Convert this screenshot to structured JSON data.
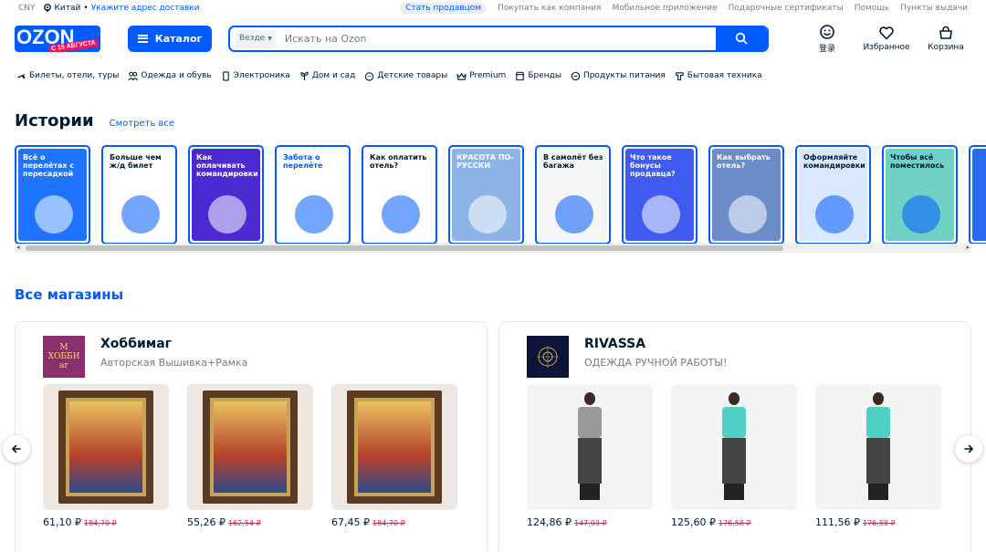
{
  "topbar": {
    "currency": "CNY",
    "location": "Китай",
    "delivery_link": "Укажите адрес доставки",
    "links": [
      "Стать продавцом",
      "Покупать как компания",
      "Мобильное приложение",
      "Подарочные сертификаты",
      "Помощь",
      "Пункты выдачи"
    ]
  },
  "header": {
    "logo_text": "OZON",
    "logo_promo": "С 15 АВГУСТА",
    "catalog_label": "Каталог",
    "search_scope": "Везде",
    "search_placeholder": "Искать на Ozon",
    "actions": [
      {
        "label": "登录",
        "icon": "smiley-icon"
      },
      {
        "label": "Избранное",
        "icon": "heart-icon"
      },
      {
        "label": "Корзина",
        "icon": "cart-icon"
      }
    ]
  },
  "categories": [
    {
      "label": "Билеты, отели, туры",
      "icon": "plane-icon"
    },
    {
      "label": "Одежда и обувь",
      "icon": "people-icon"
    },
    {
      "label": "Электроника",
      "icon": "phone-icon"
    },
    {
      "label": "Дом и сад",
      "icon": "plant-icon"
    },
    {
      "label": "Детские товары",
      "icon": "baby-icon"
    },
    {
      "label": "Premium",
      "icon": "crown-icon"
    },
    {
      "label": "Бренды",
      "icon": "store-icon"
    },
    {
      "label": "Продукты питания",
      "icon": "food-icon"
    },
    {
      "label": "Бытовая техника",
      "icon": "appliance-icon"
    }
  ],
  "stories": {
    "title": "Истории",
    "see_all": "Смотреть все",
    "items": [
      {
        "text": "Всё о перелётах с пересадкой",
        "bg": "#1e73ff",
        "color": "#ffffff"
      },
      {
        "text": "Больше чем ж/д билет",
        "bg": "#ffffff",
        "color": "#001a34"
      },
      {
        "text": "Как оплачивать командировки",
        "bg": "#4b2bd1",
        "color": "#ffffff"
      },
      {
        "text": "Забота о перелёте",
        "bg": "#ffffff",
        "color": "#005bff"
      },
      {
        "text": "Как оплатить отель?",
        "bg": "#ffffff",
        "color": "#001a34"
      },
      {
        "text": "КРАСОТА ПО-РУССКИ",
        "bg": "#8eb3e6",
        "color": "#ffffff"
      },
      {
        "text": "В самолёт без багажа",
        "bg": "#f5f5f5",
        "color": "#001a34"
      },
      {
        "text": "Что такое бонусы продавца?",
        "bg": "#3f5bf2",
        "color": "#ffffff"
      },
      {
        "text": "Как выбрать отель?",
        "bg": "#6b8cc9",
        "color": "#ffffff"
      },
      {
        "text": "Оформляйте командировки",
        "bg": "#d9e8ff",
        "color": "#001a34"
      },
      {
        "text": "Чтобы всё поместилось",
        "bg": "#6fd0c4",
        "color": "#001a34"
      },
      {
        "text": "",
        "bg": "#2a6af1",
        "color": "#ffffff"
      }
    ]
  },
  "shops": {
    "title": "Все магазины",
    "items": [
      {
        "name": "Хоббимаг",
        "desc": "Авторская Вышивка+Рамка",
        "logo_text": "М ХОББИ аг",
        "products": [
          {
            "price": "61,10 ₽",
            "old_price": "184,70 ₽"
          },
          {
            "price": "55,26 ₽",
            "old_price": "162,54 ₽"
          },
          {
            "price": "67,45 ₽",
            "old_price": "184,70 ₽"
          }
        ]
      },
      {
        "name": "RIVASSA",
        "desc": "ОДЕЖДА РУЧНОЙ РАБОТЫ!",
        "logo_text": "",
        "products": [
          {
            "price": "124,86 ₽",
            "old_price": "147,03 ₽"
          },
          {
            "price": "125,60 ₽",
            "old_price": "176,58 ₽"
          },
          {
            "price": "111,56 ₽",
            "old_price": "176,58 ₽"
          }
        ]
      }
    ]
  },
  "colors": {
    "brand": "#005bff",
    "discount": "#f91155",
    "muted": "#707f8d"
  }
}
